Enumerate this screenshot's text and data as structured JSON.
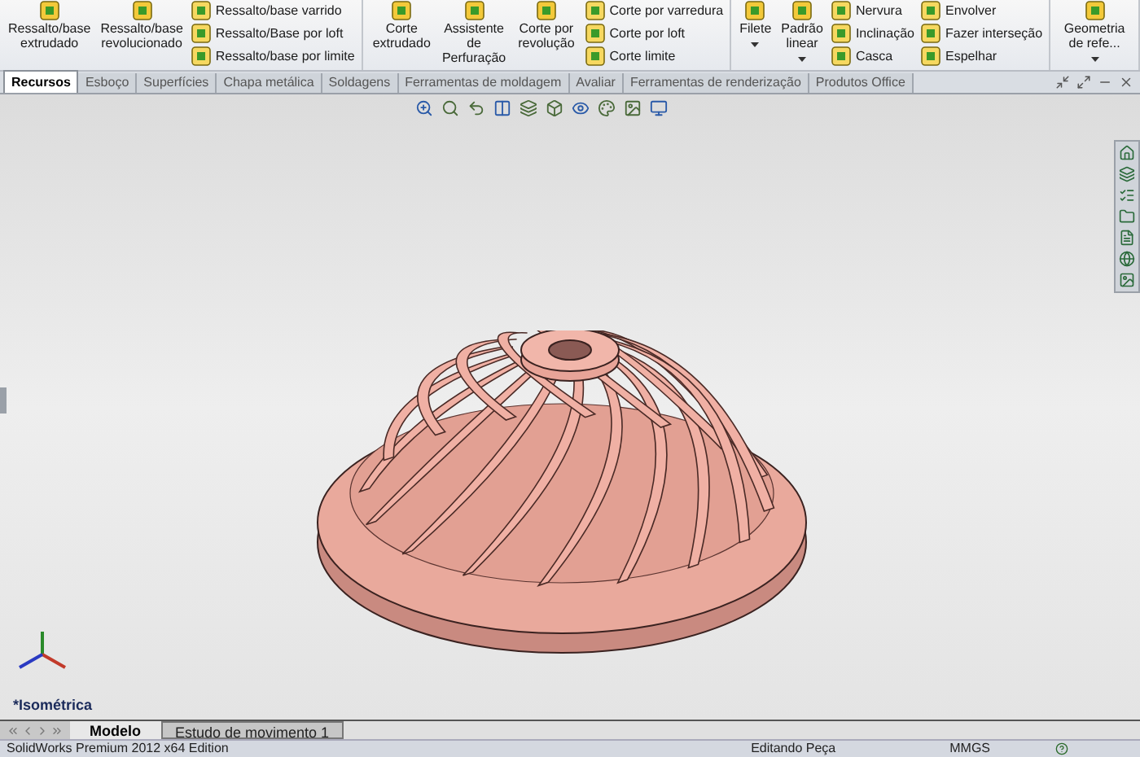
{
  "ribbon": {
    "groups": [
      {
        "buttons": [
          {
            "kind": "large",
            "label": "Ressalto/base extrudado",
            "dropdown": false
          },
          {
            "kind": "large",
            "label": "Ressalto/base revolucionado",
            "dropdown": false
          },
          {
            "kind": "stack",
            "items": [
              "Ressalto/base varrido",
              "Ressalto/Base por loft",
              "Ressalto/base por limite"
            ]
          }
        ]
      },
      {
        "buttons": [
          {
            "kind": "large",
            "label": "Corte extrudado",
            "dropdown": false
          },
          {
            "kind": "large",
            "label": "Assistente de Perfuração",
            "dropdown": false
          },
          {
            "kind": "large",
            "label": "Corte por revolução",
            "dropdown": false
          },
          {
            "kind": "stack",
            "items": [
              "Corte por varredura",
              "Corte por loft",
              "Corte limite"
            ]
          }
        ]
      },
      {
        "buttons": [
          {
            "kind": "large",
            "label": "Filete",
            "dropdown": true
          },
          {
            "kind": "large",
            "label": "Padrão linear",
            "dropdown": true
          },
          {
            "kind": "stack",
            "items": [
              "Nervura",
              "Inclinação",
              "Casca"
            ]
          },
          {
            "kind": "stack",
            "items": [
              "Envolver",
              "Fazer interseção",
              "Espelhar"
            ]
          }
        ]
      },
      {
        "buttons": [
          {
            "kind": "large",
            "label": "Geometria de refe...",
            "dropdown": true
          }
        ]
      }
    ]
  },
  "tabs": [
    {
      "label": "Recursos",
      "selected": true
    },
    {
      "label": "Esboço",
      "selected": false
    },
    {
      "label": "Superfícies",
      "selected": false
    },
    {
      "label": "Chapa metálica",
      "selected": false
    },
    {
      "label": "Soldagens",
      "selected": false
    },
    {
      "label": "Ferramentas de moldagem",
      "selected": false
    },
    {
      "label": "Avaliar",
      "selected": false
    },
    {
      "label": "Ferramentas de renderização",
      "selected": false
    },
    {
      "label": "Produtos Office",
      "selected": false
    }
  ],
  "viewport": {
    "view_name": "*Isométrica"
  },
  "bottom_tabs": [
    {
      "label": "Modelo",
      "selected": true
    },
    {
      "label": "Estudo de movimento 1",
      "selected": false
    }
  ],
  "status_bar": {
    "product": "SolidWorks Premium 2012 x64 Edition",
    "mode": "Editando Peça",
    "units": "MMGS"
  }
}
